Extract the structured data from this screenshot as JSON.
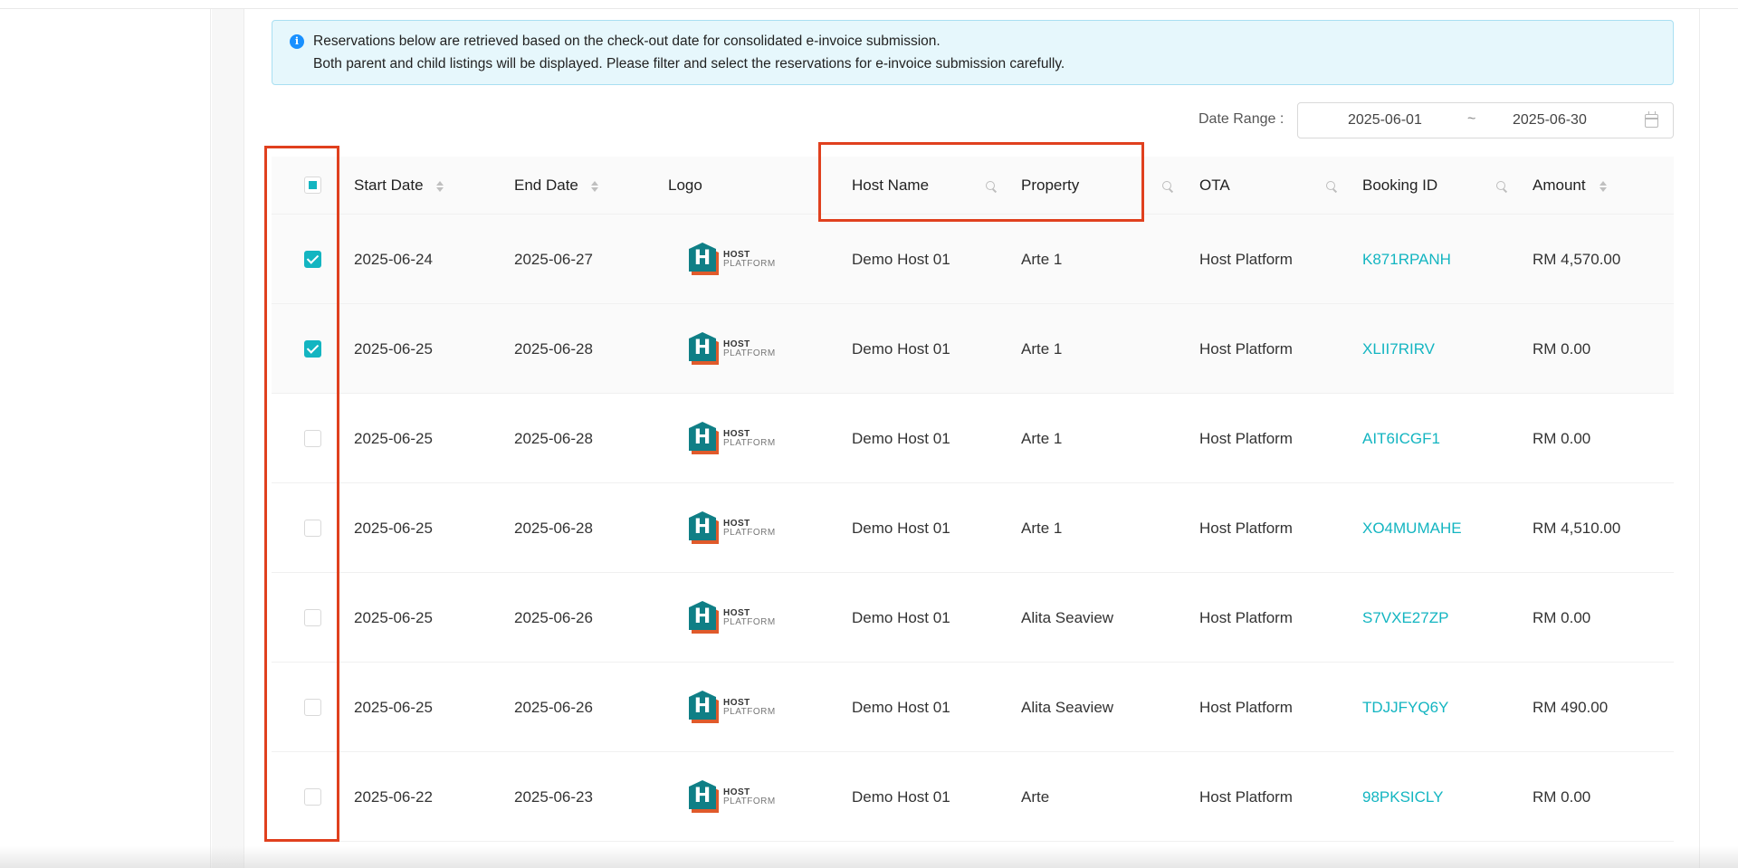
{
  "alert": {
    "icon": "info-icon",
    "line1": "Reservations below are retrieved based on the check-out date for consolidated e-invoice submission.",
    "line2": "Both parent and child listings will be displayed. Please filter and select the reservations for e-invoice submission carefully."
  },
  "date_range": {
    "label": "Date Range :",
    "start": "2025-06-01",
    "separator": "~",
    "end": "2025-06-30",
    "icon": "calendar-icon"
  },
  "table": {
    "columns": {
      "start_date": "Start Date",
      "end_date": "End Date",
      "logo": "Logo",
      "host_name": "Host Name",
      "property": "Property",
      "ota": "OTA",
      "booking_id": "Booking ID",
      "amount": "Amount"
    },
    "header_checkbox": "partial",
    "logo_text": {
      "line1": "HOST",
      "line2": "PLATFORM",
      "mark": "H"
    },
    "rows": [
      {
        "checked": true,
        "start": "2025-06-24",
        "end": "2025-06-27",
        "host": "Demo Host 01",
        "property": "Arte 1",
        "ota": "Host Platform",
        "booking_id": "K871RPANH",
        "amount": "RM 4,570.00"
      },
      {
        "checked": true,
        "start": "2025-06-25",
        "end": "2025-06-28",
        "host": "Demo Host 01",
        "property": "Arte 1",
        "ota": "Host Platform",
        "booking_id": "XLII7RIRV",
        "amount": "RM 0.00"
      },
      {
        "checked": false,
        "start": "2025-06-25",
        "end": "2025-06-28",
        "host": "Demo Host 01",
        "property": "Arte 1",
        "ota": "Host Platform",
        "booking_id": "AIT6ICGF1",
        "amount": "RM 0.00"
      },
      {
        "checked": false,
        "start": "2025-06-25",
        "end": "2025-06-28",
        "host": "Demo Host 01",
        "property": "Arte 1",
        "ota": "Host Platform",
        "booking_id": "XO4MUMAHE",
        "amount": "RM 4,510.00"
      },
      {
        "checked": false,
        "start": "2025-06-25",
        "end": "2025-06-26",
        "host": "Demo Host 01",
        "property": "Alita Seaview",
        "ota": "Host Platform",
        "booking_id": "S7VXE27ZP",
        "amount": "RM 0.00"
      },
      {
        "checked": false,
        "start": "2025-06-25",
        "end": "2025-06-26",
        "host": "Demo Host 01",
        "property": "Alita Seaview",
        "ota": "Host Platform",
        "booking_id": "TDJJFYQ6Y",
        "amount": "RM 490.00"
      },
      {
        "checked": false,
        "start": "2025-06-22",
        "end": "2025-06-23",
        "host": "Demo Host 01",
        "property": "Arte",
        "ota": "Host Platform",
        "booking_id": "98PKSICLY",
        "amount": "RM 0.00"
      }
    ]
  },
  "colors": {
    "accent": "#13b5c1",
    "annotation": "#e0401e",
    "alert_bg": "#e6f7fc",
    "info": "#1890ff"
  }
}
